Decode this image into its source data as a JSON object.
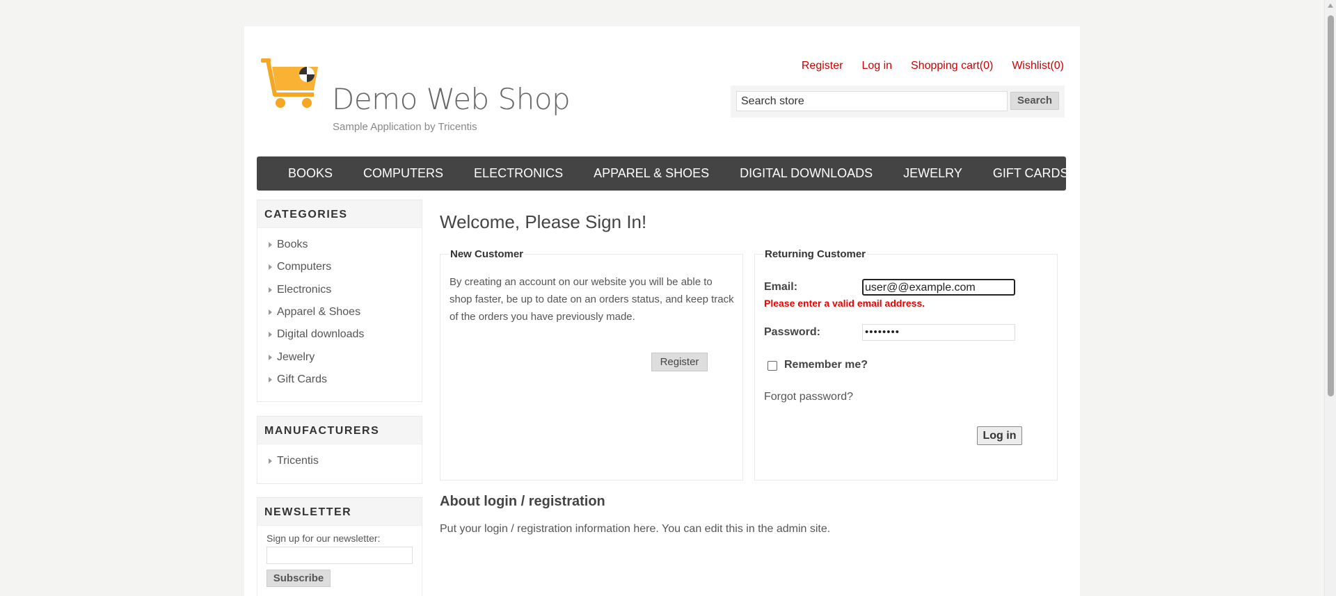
{
  "header": {
    "shop_name": "Demo Web Shop",
    "tagline": "Sample Application by Tricentis",
    "links": {
      "register": "Register",
      "login": "Log in",
      "cart": "Shopping cart(0)",
      "wishlist": "Wishlist(0)"
    },
    "search": {
      "value": "Search store",
      "button": "Search"
    }
  },
  "topmenu": [
    "BOOKS",
    "COMPUTERS",
    "ELECTRONICS",
    "APPAREL & SHOES",
    "DIGITAL DOWNLOADS",
    "JEWELRY",
    "GIFT CARDS"
  ],
  "sidebar": {
    "categories": {
      "title": "CATEGORIES",
      "items": [
        "Books",
        "Computers",
        "Electronics",
        "Apparel & Shoes",
        "Digital downloads",
        "Jewelry",
        "Gift Cards"
      ]
    },
    "manufacturers": {
      "title": "MANUFACTURERS",
      "items": [
        "Tricentis"
      ]
    },
    "newsletter": {
      "title": "NEWSLETTER",
      "label": "Sign up for our newsletter:",
      "button": "Subscribe"
    }
  },
  "main": {
    "title": "Welcome, Please Sign In!",
    "new_customer": {
      "title": "New Customer",
      "description": "By creating an account on our website you will be able to shop faster, be up to date on an orders status, and keep track of the orders you have previously made.",
      "button": "Register"
    },
    "returning": {
      "title": "Returning Customer",
      "email_label": "Email:",
      "email_value": "user@@example.com",
      "email_error": "Please enter a valid email address.",
      "password_label": "Password:",
      "password_value": "••••••••",
      "remember_label": "Remember me?",
      "forgot": "Forgot password?",
      "login_button": "Log in"
    },
    "about": {
      "title": "About login / registration",
      "text": "Put your login / registration information here. You can edit this in the admin site."
    }
  },
  "colors": {
    "link_red": "#cc0000",
    "menu_bg": "#444444",
    "error_red": "#ee0000",
    "logo_orange": "#f9a825"
  }
}
